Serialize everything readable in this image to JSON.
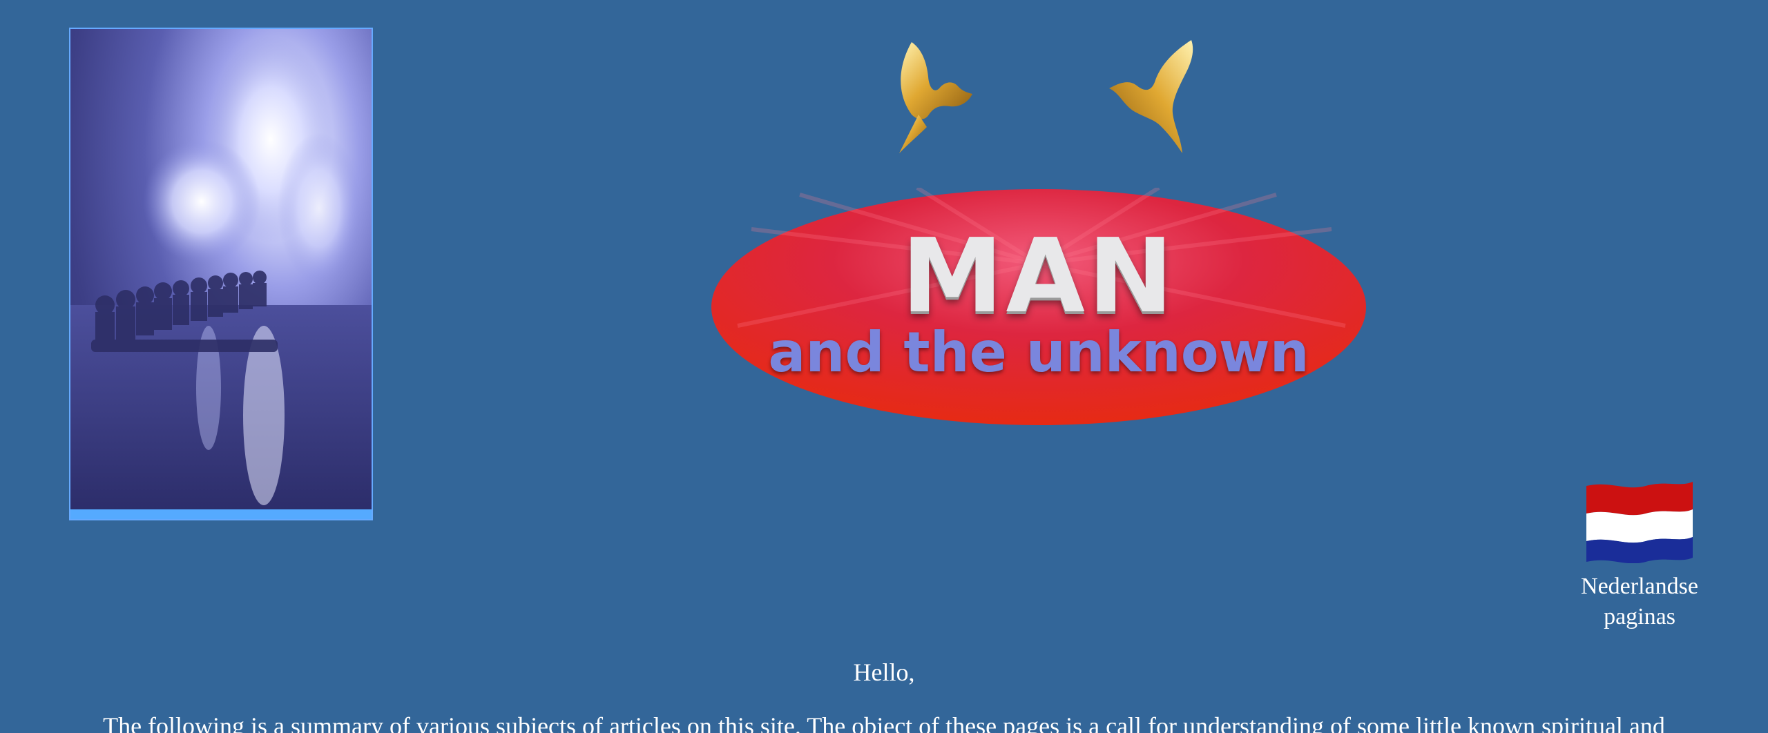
{
  "header": {
    "logo_title": "MAN",
    "logo_subtitle": "and the unknown",
    "photo_alt": "Fountain with statues",
    "dove_icon": "dove-icon"
  },
  "language_link": {
    "label": "Nederlandse paginas",
    "flag_icon": "netherlands-flag-icon",
    "flag_colors": [
      "#cc1111",
      "#ffffff",
      "#1a2d99"
    ]
  },
  "content": {
    "greeting": "Hello,",
    "intro": "The following is a summary of various subjects of articles on this site. The object of these pages is a call for understanding of some little known spiritual and"
  },
  "colors": {
    "background": "#336699",
    "logo_red": "#dd2233",
    "logo_subtitle": "#7a86dd"
  }
}
